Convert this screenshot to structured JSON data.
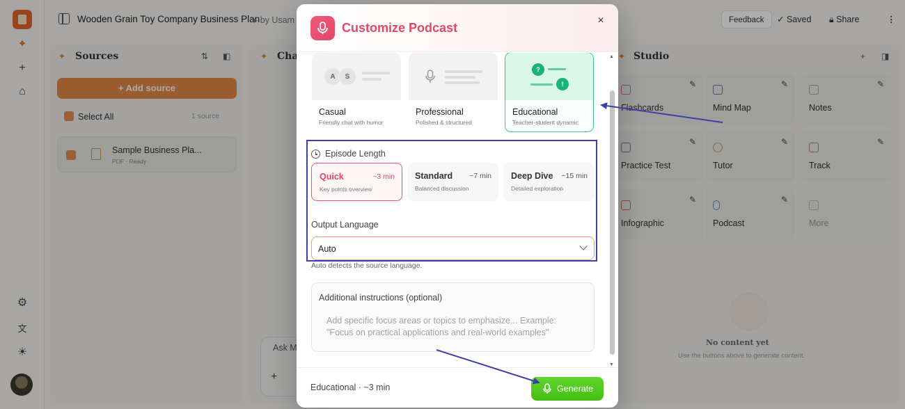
{
  "app": {
    "notebook_title": "Wooden Grain Toy Company Business Plan",
    "byline": "▸ by Usam",
    "feedback_label": "Feedback",
    "saved_label": "Saved",
    "share_label": "Share",
    "more_label": "⋮"
  },
  "sources": {
    "title": "Sources",
    "add_label": "+ Add source",
    "select_all_label": "Select All",
    "count_label": "1 source",
    "items": [
      {
        "name": "Sample Business Pla...",
        "meta": "PDF · Ready"
      }
    ]
  },
  "chat": {
    "title": "Chat",
    "input_placeholder": "Ask M",
    "plus_label": "+"
  },
  "studio": {
    "title": "Studio",
    "tiles": [
      {
        "label": "Flashcards"
      },
      {
        "label": "Mind Map"
      },
      {
        "label": "Notes"
      },
      {
        "label": "Practice Test"
      },
      {
        "label": "Tutor"
      },
      {
        "label": "Track"
      },
      {
        "label": "Infographic"
      },
      {
        "label": "Podcast"
      },
      {
        "label": "More"
      }
    ],
    "empty_title": "No content yet",
    "empty_sub": "Use the buttons above to generate content."
  },
  "modal": {
    "title": "Customize Podcast",
    "close_label": "×",
    "styles": [
      {
        "name": "Casual",
        "desc": "Friendly chat with humor",
        "avatars": [
          "A",
          "S"
        ]
      },
      {
        "name": "Professional",
        "desc": "Polished & structured"
      },
      {
        "name": "Educational",
        "desc": "Teacher-student dynamic",
        "marks": [
          "?",
          "!"
        ],
        "selected": true
      }
    ],
    "episode_length_label": "Episode Length",
    "lengths": [
      {
        "name": "Quick",
        "time": "~3 min",
        "desc": "Key points overview",
        "selected": true
      },
      {
        "name": "Standard",
        "time": "~7 min",
        "desc": "Balanced discussion"
      },
      {
        "name": "Deep Dive",
        "time": "~15 min",
        "desc": "Detailed exploration"
      }
    ],
    "output_language_label": "Output Language",
    "language_value": "Auto",
    "language_hint": "Auto detects the source language.",
    "instructions_label": "Additional instructions (optional)",
    "instructions_placeholder": "Add specific focus areas or topics to emphasize...  Example: \"Focus on practical applications and real-world examples\"",
    "footer_summary": "Educational  ·  ~3 min",
    "generate_label": "Generate"
  },
  "colors": {
    "accent_pink": "#e0496a",
    "accent_green": "#45bf12",
    "annotation_blue": "#3d3fa9",
    "brand_orange": "#e0782c"
  }
}
